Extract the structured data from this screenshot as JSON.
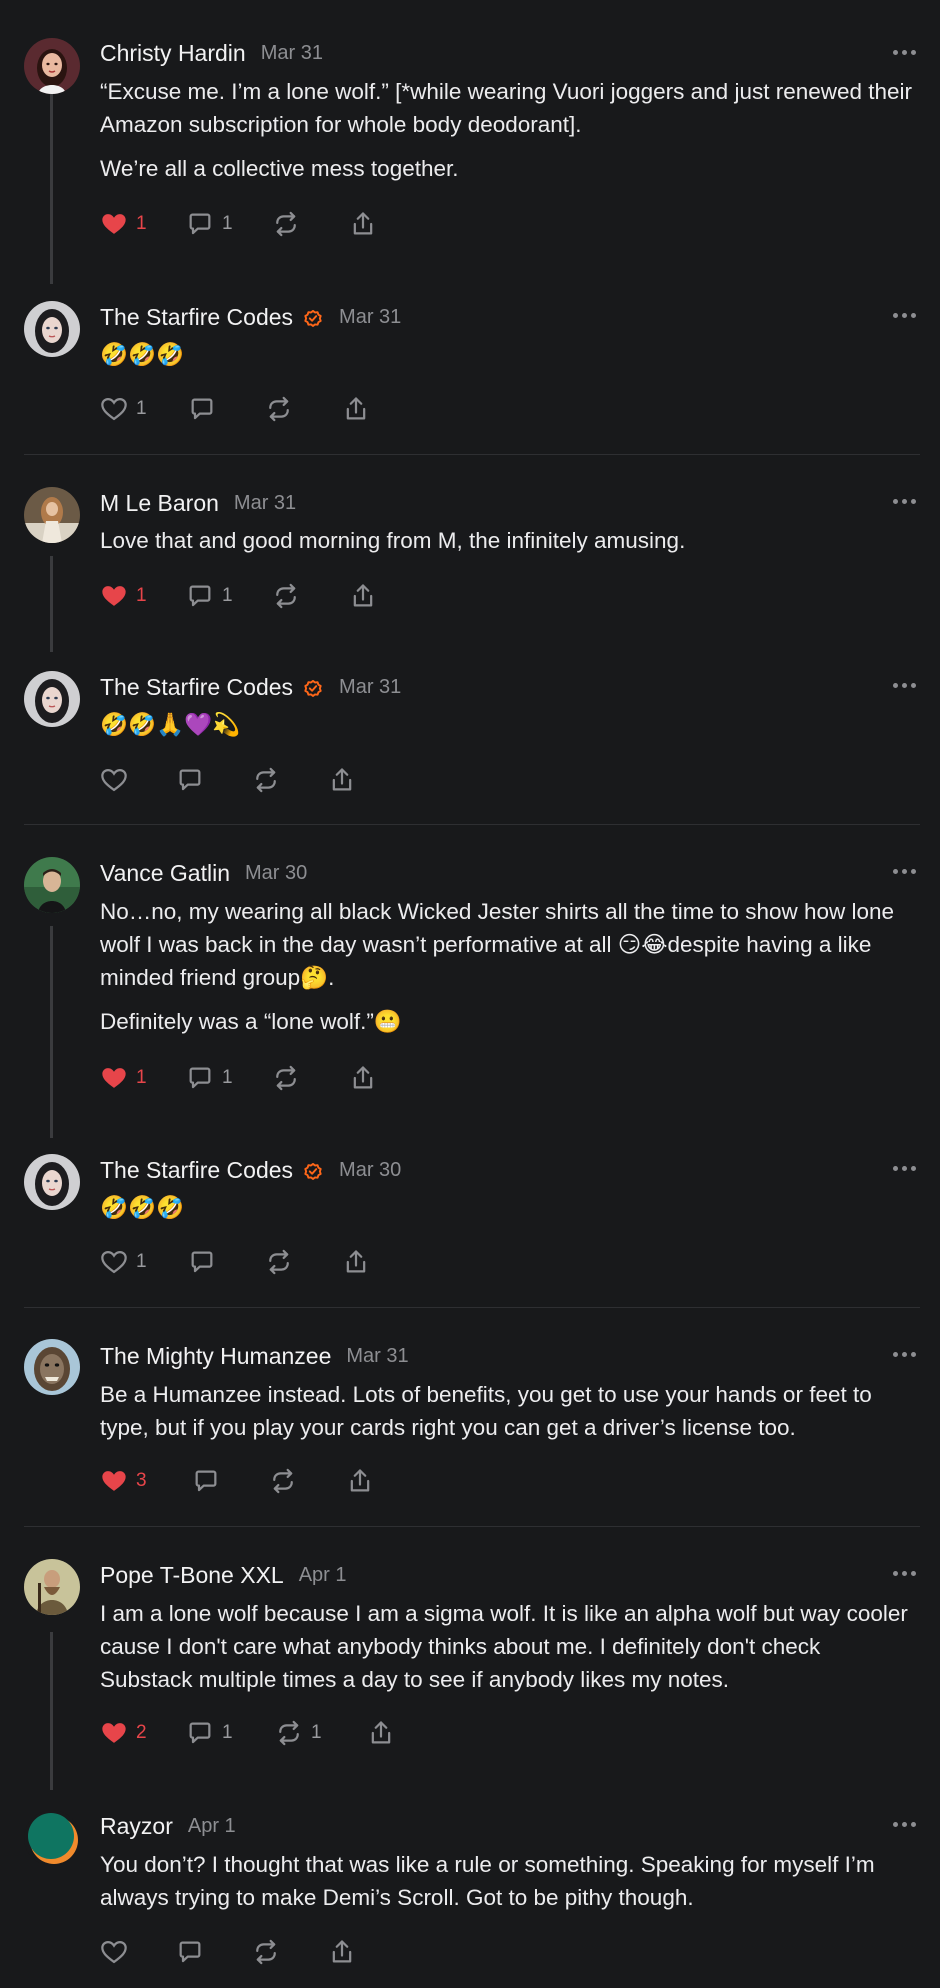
{
  "posts": [
    {
      "author": "Christy Hardin",
      "date": "Mar 31",
      "verified": false,
      "paragraphs": [
        "“Excuse me. I’m a lone wolf.” [*while wearing Vuori joggers and just renewed their Amazon subscription for whole body deodorant].",
        "We’re all a collective mess together."
      ],
      "likes": "1",
      "liked": true,
      "comments": "1",
      "restacks": ""
    },
    {
      "author": "The Starfire Codes",
      "date": "Mar 31",
      "verified": true,
      "paragraphs": [
        "🤣🤣🤣"
      ],
      "likes": "1",
      "liked": false,
      "comments": "",
      "restacks": ""
    },
    {
      "author": "M Le Baron",
      "date": "Mar 31",
      "verified": false,
      "paragraphs": [
        "Love that and good morning from M, the infinitely amusing."
      ],
      "likes": "1",
      "liked": true,
      "comments": "1",
      "restacks": ""
    },
    {
      "author": "The Starfire Codes",
      "date": "Mar 31",
      "verified": true,
      "paragraphs": [
        "🤣🤣🙏💜💫"
      ],
      "likes": "",
      "liked": false,
      "comments": "",
      "restacks": ""
    },
    {
      "author": "Vance Gatlin",
      "date": "Mar 30",
      "verified": false,
      "paragraphs": [
        "No…no, my wearing all black Wicked Jester shirts all the time to show how lone wolf I was back in the day wasn’t performative at all 😏😂despite having a like minded friend group🤔.",
        "Definitely was a “lone wolf.”😬"
      ],
      "likes": "1",
      "liked": true,
      "comments": "1",
      "restacks": ""
    },
    {
      "author": "The Starfire Codes",
      "date": "Mar 30",
      "verified": true,
      "paragraphs": [
        "🤣🤣🤣"
      ],
      "likes": "1",
      "liked": false,
      "comments": "",
      "restacks": ""
    },
    {
      "author": "The Mighty Humanzee",
      "date": "Mar 31",
      "verified": false,
      "paragraphs": [
        "Be a Humanzee instead. Lots of benefits, you get to use your hands or feet to type, but if you play your cards right you can get a driver’s license too."
      ],
      "likes": "3",
      "liked": true,
      "comments": "",
      "restacks": ""
    },
    {
      "author": "Pope T-Bone XXL",
      "date": "Apr 1",
      "verified": false,
      "paragraphs": [
        "I am a lone wolf because I am a sigma wolf. It is like an alpha wolf but way cooler cause I don't care what anybody thinks about me. I definitely don't check Substack multiple times a day to see if anybody likes my notes."
      ],
      "likes": "2",
      "liked": true,
      "comments": "1",
      "restacks": "1"
    },
    {
      "author": "Rayzor",
      "date": "Apr 1",
      "verified": false,
      "paragraphs": [
        "You don’t? I thought that was like a rule or something. Speaking for myself I’m always trying to make Demi’s Scroll. Got to be pithy though."
      ],
      "likes": "",
      "liked": false,
      "comments": "",
      "restacks": ""
    }
  ],
  "icons": {
    "like": "heart-icon",
    "comment": "comment-icon",
    "restack": "restack-icon",
    "share": "share-icon",
    "more": "more-icon",
    "verified": "verified-check-icon"
  },
  "colors": {
    "background": "#18191b",
    "liked": "#e7454a",
    "accent": "#ff6719",
    "muted": "#8d8e92"
  }
}
